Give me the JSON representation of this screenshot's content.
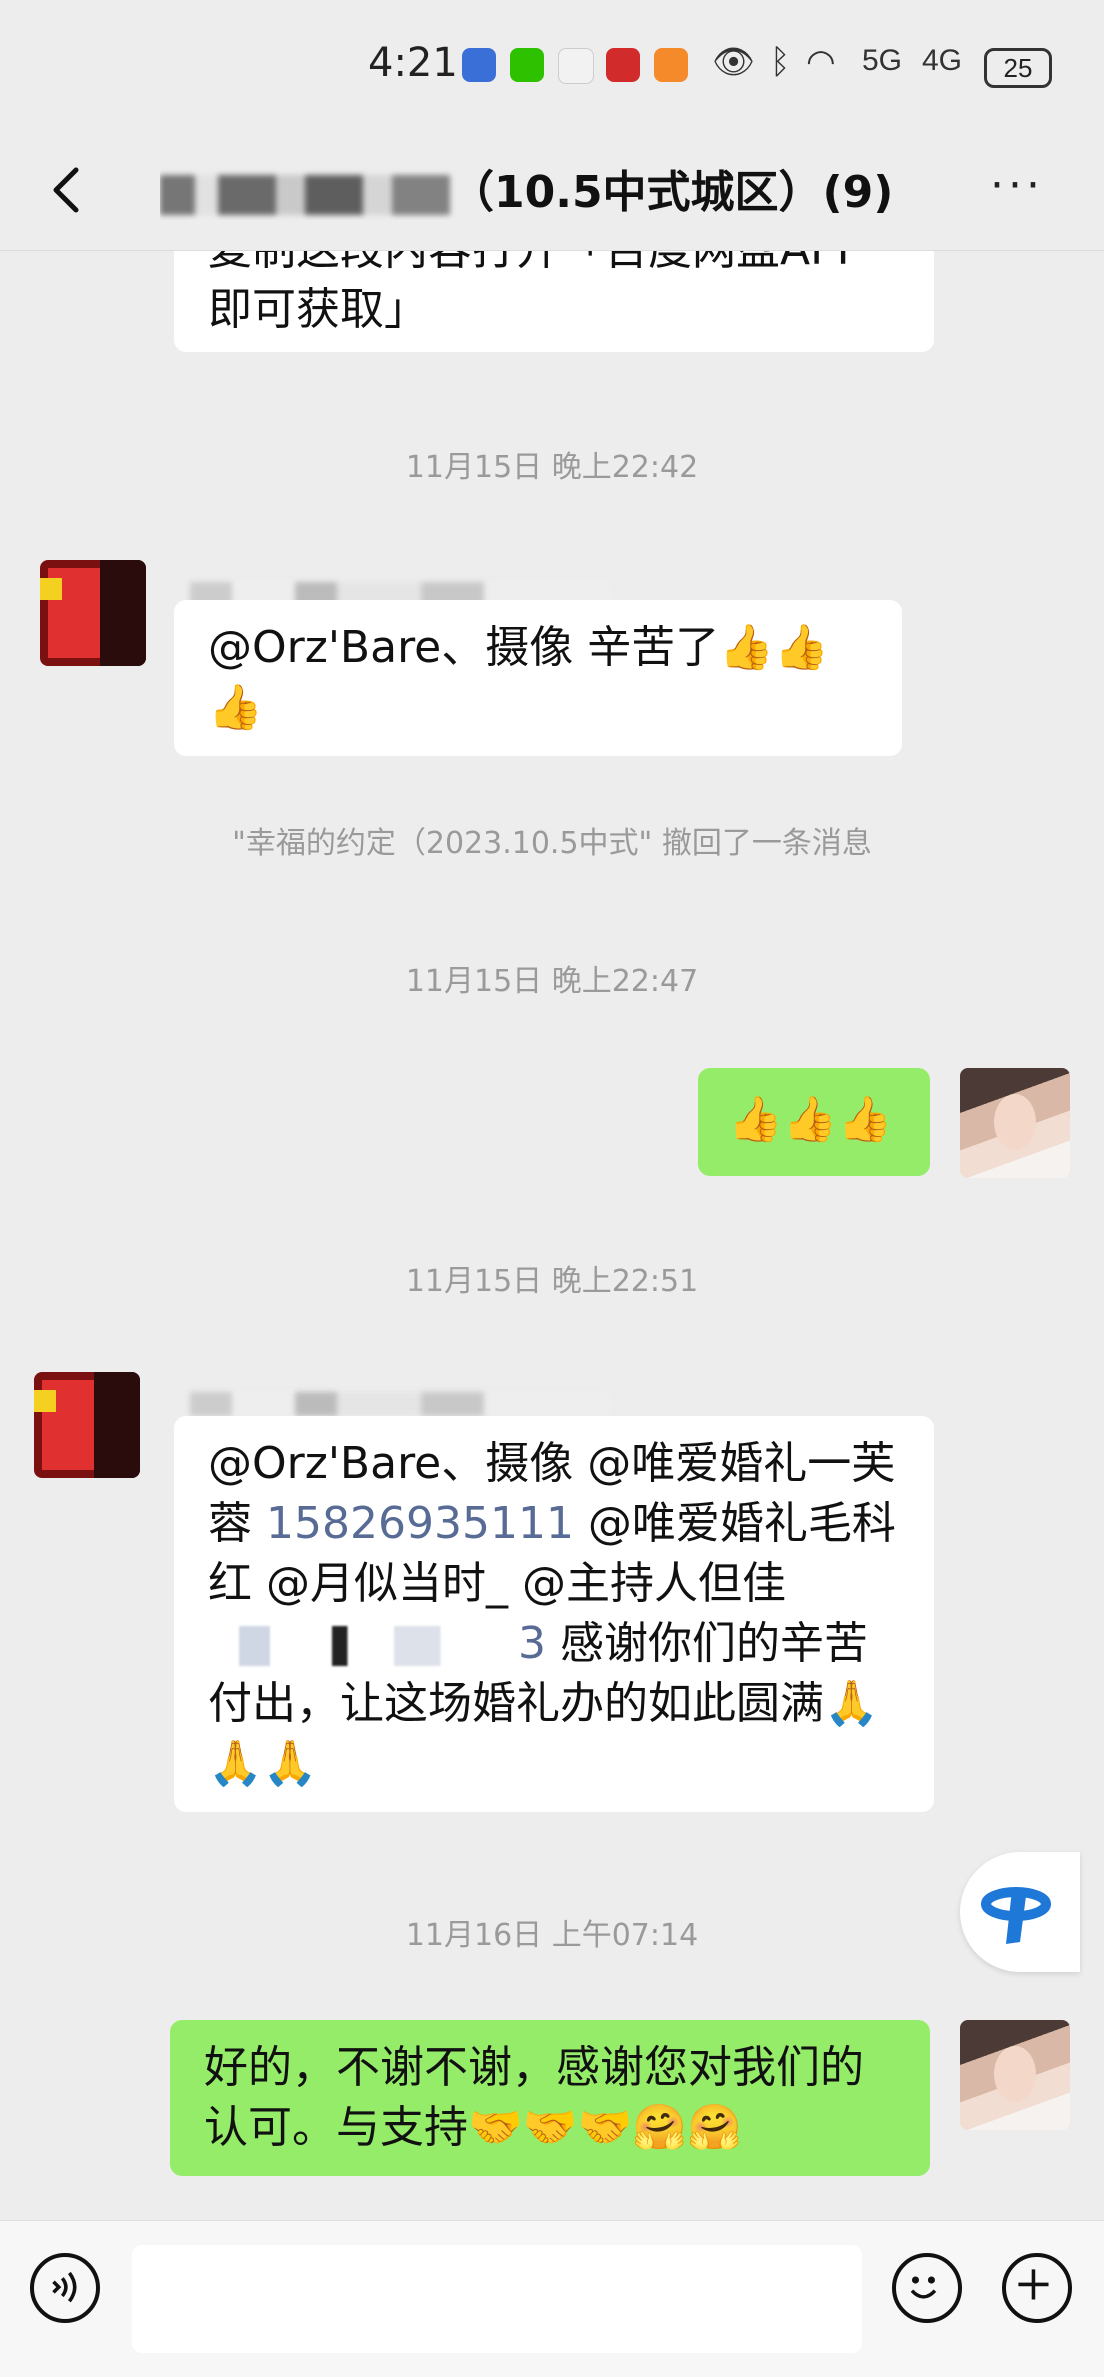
{
  "status": {
    "time": "4:21",
    "network1": "5G",
    "network2": "4G",
    "battery": "25"
  },
  "header": {
    "title_visible": "（10.5中式城区）(9)",
    "more_glyph": "···"
  },
  "messages": [
    {
      "type": "in-bubble",
      "text": "复制这段内容打开「百度网盘APP 即可获取」"
    },
    {
      "type": "timestamp",
      "text": "11月15日 晚上22:42"
    },
    {
      "type": "in",
      "text": "@Orz'Bare、摄像  辛苦了👍👍👍"
    },
    {
      "type": "system",
      "text": "\"幸福的约定（2023.10.5中式\" 撤回了一条消息"
    },
    {
      "type": "timestamp",
      "text": "11月15日 晚上22:47"
    },
    {
      "type": "out",
      "text": "👍👍👍"
    },
    {
      "type": "timestamp",
      "text": "11月15日 晚上22:51"
    },
    {
      "type": "in",
      "part1": "@Orz'Bare、摄像 @唯爱婚礼一芙蓉 ",
      "phone": "15826935111",
      "part2": " @唯爱婚礼毛科红 @月似当时_ @主持人但佳",
      "tail_digit": "3",
      "part3": " 感谢你们的辛苦付出，让这场婚礼办的如此圆满🙏🙏🙏"
    },
    {
      "type": "timestamp",
      "text": "11月16日 上午07:14"
    },
    {
      "type": "out",
      "text": "好的，不谢不谢，感谢您对我们的认可。与支持🤝🤝🤝🤗🤗"
    }
  ],
  "bottom": {
    "voice_icon": "voice-icon",
    "emoji_icon": "emoji-icon",
    "plus_icon": "plus-icon"
  }
}
